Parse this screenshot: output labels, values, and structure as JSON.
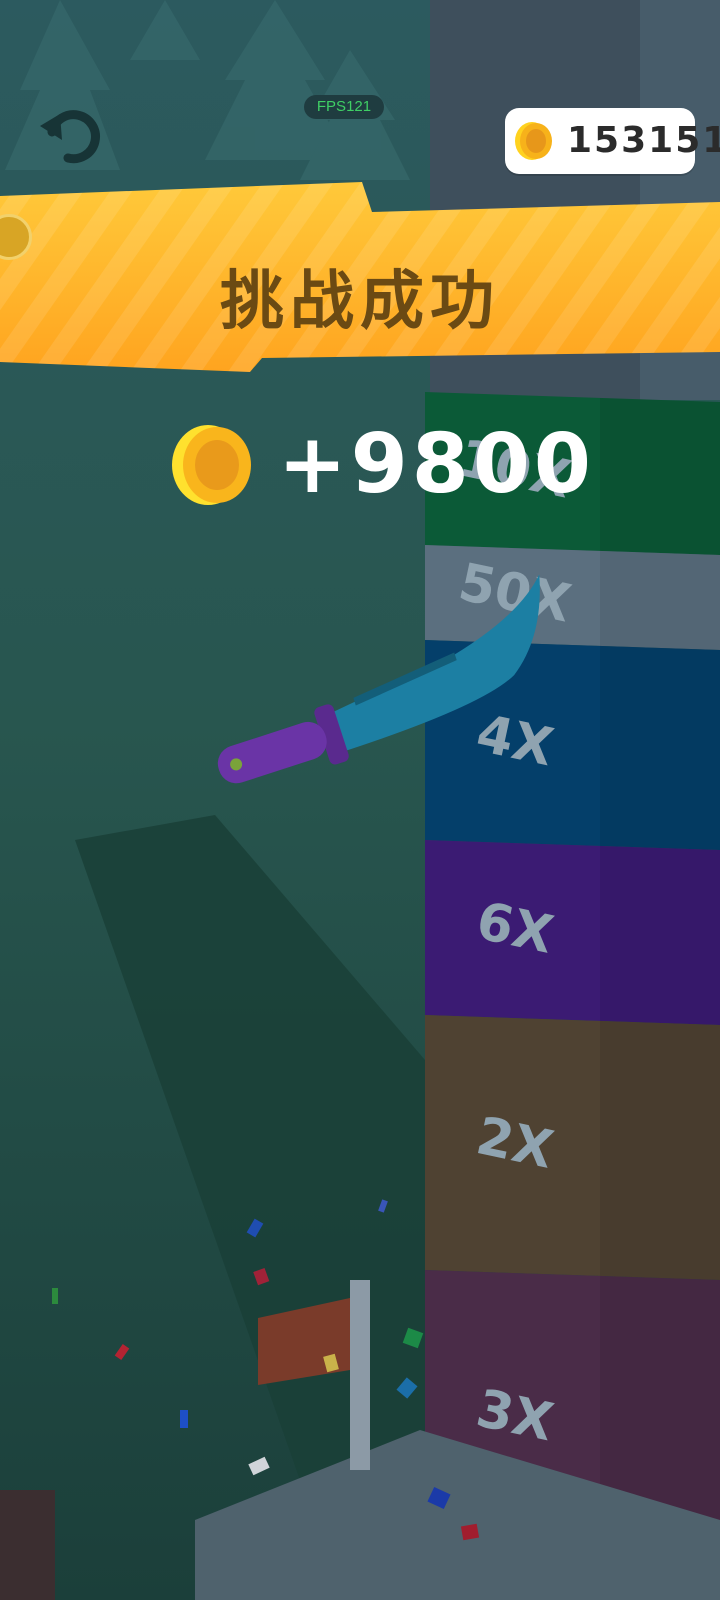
{
  "hud": {
    "fps": "FPS121",
    "coins": "153151",
    "restart_icon": "restart-icon",
    "coin_icon": "coin-icon"
  },
  "result": {
    "title": "挑战成功",
    "reward": "+9800"
  },
  "tower": {
    "blocks": [
      {
        "label": "10X",
        "color": "#0b5a37"
      },
      {
        "label": "50X",
        "color": "#5b6f7f"
      },
      {
        "label": "4X",
        "color": "#043f6a"
      },
      {
        "label": "6X",
        "color": "#3b1b73"
      },
      {
        "label": "2X",
        "color": "#4f4232"
      },
      {
        "label": "3X",
        "color": "#4a2c48"
      }
    ]
  },
  "colors": {
    "banner": "#ffb02a",
    "banner_text": "#6b4a13",
    "knife_blade": "#1c7fa3",
    "knife_handle": "#5c2a92",
    "fps_text": "#3fcf65"
  }
}
